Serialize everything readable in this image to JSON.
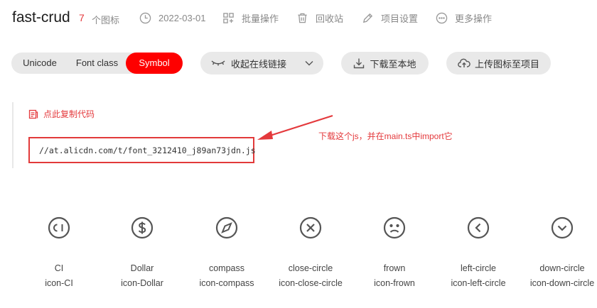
{
  "header": {
    "title": "fast-crud",
    "icon_count": "7",
    "icon_count_label": "个图标",
    "date": "2022-03-01",
    "batch_label": "批量操作",
    "trash_label": "回收站",
    "settings_label": "项目设置",
    "more_label": "更多操作"
  },
  "tabs": {
    "unicode": "Unicode",
    "font_class": "Font class",
    "symbol": "Symbol",
    "active": "Symbol"
  },
  "actions": {
    "collapse_link": "收起在线链接",
    "download": "下载至本地",
    "upload": "上传图标至项目"
  },
  "code": {
    "copy_label": "点此复制代码",
    "url": "//at.alicdn.com/t/font_3212410_j89an73jdn.js",
    "annotation": "下载这个js，并在main.ts中import它"
  },
  "colors": {
    "accent": "#fe0000",
    "annotation": "#e4393c",
    "pill_bg": "#e9e9e9"
  },
  "icons": [
    {
      "name": "CI",
      "class": "icon-CI",
      "glyph": "ci-circle-icon"
    },
    {
      "name": "Dollar",
      "class": "icon-Dollar",
      "glyph": "dollar-circle-icon"
    },
    {
      "name": "compass",
      "class": "icon-compass",
      "glyph": "compass-icon"
    },
    {
      "name": "close-circle",
      "class": "icon-close-circle",
      "glyph": "close-circle-icon"
    },
    {
      "name": "frown",
      "class": "icon-frown",
      "glyph": "frown-icon"
    },
    {
      "name": "left-circle",
      "class": "icon-left-circle",
      "glyph": "left-circle-icon"
    },
    {
      "name": "down-circle",
      "class": "icon-down-circle",
      "glyph": "down-circle-icon"
    }
  ]
}
